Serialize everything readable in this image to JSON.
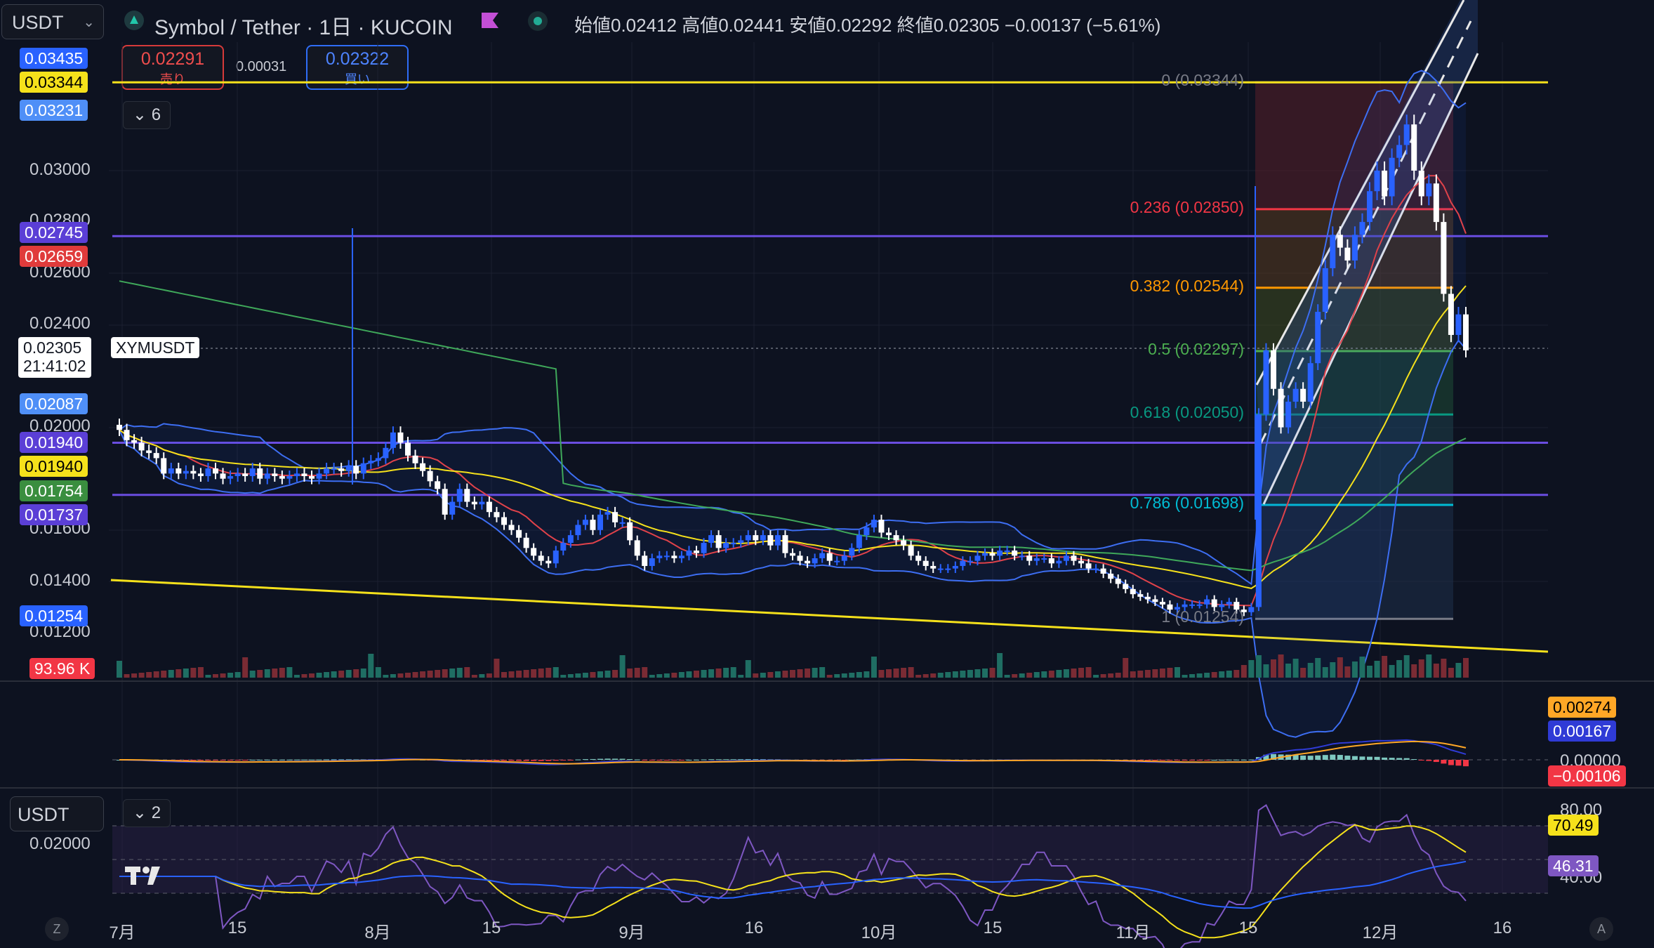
{
  "header": {
    "currency": "USDT",
    "symbol_line": "Symbol / Tether · 1日 · KUCOIN",
    "ohlc_line": "始値0.02412  高値0.02441  安値0.02292  終値0.02305  −0.00137 (−5.61%)"
  },
  "trade": {
    "sell_price": "0.02291",
    "sell_label": "売り",
    "spread": "0.00031",
    "buy_price": "0.02322",
    "buy_label": "買い"
  },
  "main_pane": {
    "indicator_count": "6",
    "y_ticks": [
      "0.03000",
      "0.02800",
      "0.02600",
      "0.02400",
      "0.02000",
      "0.01600",
      "0.01400",
      "0.01200"
    ],
    "price_tags": [
      {
        "text": "0.03435",
        "color": "#2962ff",
        "fg": "#ffffff",
        "value": 0.03435
      },
      {
        "text": "0.03344",
        "color": "#f5e11b",
        "fg": "#000000",
        "value": 0.03344
      },
      {
        "text": "0.03231",
        "color": "#4f8ff7",
        "fg": "#ffffff",
        "value": 0.03231
      },
      {
        "text": "0.02745",
        "color": "#5b3fd6",
        "fg": "#ffffff",
        "value": 0.02745
      },
      {
        "text": "0.02659",
        "color": "#e03b3b",
        "fg": "#ffffff",
        "value": 0.02659
      },
      {
        "text": "0.02087",
        "color": "#4f8ff7",
        "fg": "#ffffff",
        "value": 0.02087
      },
      {
        "text": "0.01940",
        "color": "#5b3fd6",
        "fg": "#ffffff",
        "value": 0.0194
      },
      {
        "text": "0.01940",
        "color": "#f5e11b",
        "fg": "#000000",
        "value": 0.0194
      },
      {
        "text": "0.01754",
        "color": "#3a8e3f",
        "fg": "#ffffff",
        "value": 0.01754
      },
      {
        "text": "0.01737",
        "color": "#5b3fd6",
        "fg": "#ffffff",
        "value": 0.01737
      },
      {
        "text": "0.01254",
        "color": "#2962ff",
        "fg": "#ffffff",
        "value": 0.01254
      }
    ],
    "last_price": "0.02305",
    "countdown": "21:41:02",
    "ticker": "XYMUSDT",
    "volume_tag": "93.96 K"
  },
  "fib_levels": [
    {
      "label": "0 (0.03344)",
      "value": 0.03344,
      "color": "#787b86"
    },
    {
      "label": "0.236 (0.02850)",
      "value": 0.0285,
      "color": "#f23645"
    },
    {
      "label": "0.382 (0.02544)",
      "value": 0.02544,
      "color": "#ff9800"
    },
    {
      "label": "0.5 (0.02297)",
      "value": 0.02297,
      "color": "#4caf50"
    },
    {
      "label": "0.618 (0.02050)",
      "value": 0.0205,
      "color": "#089981"
    },
    {
      "label": "0.786 (0.01698)",
      "value": 0.01698,
      "color": "#00bcd4"
    },
    {
      "label": "1 (0.01254)",
      "value": 0.01254,
      "color": "#787b86"
    }
  ],
  "macd_pane": {
    "tags": [
      {
        "text": "0.00274",
        "color": "#ffa726",
        "fg": "#000000"
      },
      {
        "text": "0.00167",
        "color": "#2f3bd6",
        "fg": "#ffffff"
      },
      {
        "text": "−0.00106",
        "color": "#f23645",
        "fg": "#ffffff"
      }
    ],
    "zero_label": "0.00000"
  },
  "rsi_pane": {
    "currency": "USDT",
    "indicator_count": "2",
    "y_ticks": [
      "0.02000",
      "80.00",
      "40.00"
    ],
    "tags": [
      {
        "text": "70.49",
        "color": "#f5e11b",
        "fg": "#000000"
      },
      {
        "text": "46.31",
        "color": "#7e57c2",
        "fg": "#ffffff"
      }
    ]
  },
  "x_axis": {
    "labels": [
      "7月",
      "15",
      "8月",
      "15",
      "9月",
      "16",
      "10月",
      "15",
      "11月",
      "15",
      "12月",
      "16"
    ]
  },
  "corner": {
    "left": "Z",
    "right": "A"
  },
  "chart_data": {
    "type": "candlestick",
    "title": "Symbol / Tether · 1日 · KUCOIN",
    "ylim": [
      0.0112,
      0.0345
    ],
    "closes": [
      0.0199,
      0.0195,
      0.0194,
      0.0191,
      0.019,
      0.0188,
      0.0182,
      0.0184,
      0.0182,
      0.0183,
      0.0182,
      0.0181,
      0.0184,
      0.0182,
      0.018,
      0.0181,
      0.0182,
      0.0181,
      0.0184,
      0.018,
      0.0182,
      0.0181,
      0.018,
      0.0181,
      0.0182,
      0.0181,
      0.018,
      0.0182,
      0.0184,
      0.0184,
      0.0183,
      0.0185,
      0.0182,
      0.0186,
      0.0187,
      0.0188,
      0.0192,
      0.0198,
      0.0194,
      0.0189,
      0.0186,
      0.0183,
      0.0179,
      0.0176,
      0.0166,
      0.0171,
      0.0176,
      0.0171,
      0.017,
      0.0171,
      0.0167,
      0.0165,
      0.0162,
      0.016,
      0.0157,
      0.0153,
      0.015,
      0.0148,
      0.0147,
      0.0152,
      0.0155,
      0.0158,
      0.0162,
      0.0164,
      0.016,
      0.0166,
      0.0167,
      0.0163,
      0.0163,
      0.0156,
      0.015,
      0.0146,
      0.0149,
      0.015,
      0.015,
      0.0149,
      0.015,
      0.0152,
      0.0151,
      0.0155,
      0.0158,
      0.0153,
      0.0155,
      0.0155,
      0.0156,
      0.0158,
      0.0156,
      0.0158,
      0.0154,
      0.0158,
      0.0151,
      0.015,
      0.0148,
      0.0147,
      0.0149,
      0.0151,
      0.0148,
      0.0148,
      0.015,
      0.0153,
      0.0158,
      0.0161,
      0.0164,
      0.0159,
      0.0158,
      0.0156,
      0.0154,
      0.015,
      0.0148,
      0.0146,
      0.0145,
      0.0145,
      0.0145,
      0.0146,
      0.0148,
      0.0148,
      0.015,
      0.0151,
      0.015,
      0.0152,
      0.0152,
      0.015,
      0.015,
      0.0148,
      0.0149,
      0.0149,
      0.0147,
      0.0148,
      0.015,
      0.0148,
      0.0147,
      0.0145,
      0.0145,
      0.0143,
      0.0141,
      0.0139,
      0.0137,
      0.0135,
      0.0134,
      0.0133,
      0.0132,
      0.0131,
      0.0129,
      0.013,
      0.0131,
      0.0131,
      0.0131,
      0.0133,
      0.013,
      0.0131,
      0.0132,
      0.0129,
      0.0128,
      0.013,
      0.0205,
      0.023,
      0.0215,
      0.02,
      0.021,
      0.0215,
      0.021,
      0.0225,
      0.0245,
      0.0262,
      0.0275,
      0.027,
      0.0265,
      0.0275,
      0.028,
      0.0292,
      0.03,
      0.029,
      0.0305,
      0.031,
      0.0318,
      0.03,
      0.029,
      0.0295,
      0.028,
      0.0252,
      0.0236,
      0.0244,
      0.023
    ]
  }
}
